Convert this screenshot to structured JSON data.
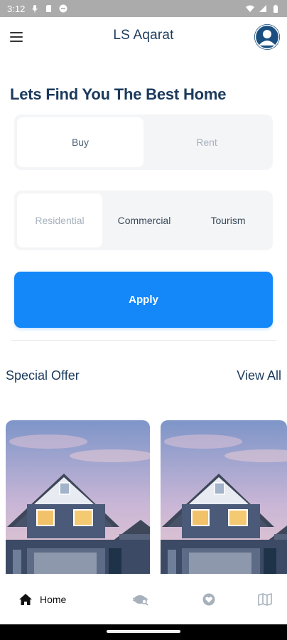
{
  "status_bar": {
    "time": "3:12",
    "icons_left": [
      "mic-icon",
      "sd-card-icon",
      "no-entry-icon"
    ],
    "icons_right": [
      "wifi-icon",
      "signal-icon",
      "battery-icon"
    ]
  },
  "app_bar": {
    "title": "LS Aqarat",
    "menu_icon": "hamburger-menu-icon",
    "avatar_icon": "user-avatar-icon"
  },
  "hero": {
    "title": "Lets Find You The Best Home"
  },
  "listing_type": {
    "options": [
      "Buy",
      "Rent"
    ],
    "selected": "Buy"
  },
  "property_category": {
    "options": [
      "Residential",
      "Commercial",
      "Tourism"
    ],
    "selected": "Residential"
  },
  "apply_label": "Apply",
  "special_offer": {
    "title": "Special Offer",
    "view_all_label": "View All"
  },
  "bottom_nav": {
    "items": [
      {
        "icon": "home-icon",
        "label": "Home",
        "active": true
      },
      {
        "icon": "globe-search-icon"
      },
      {
        "icon": "heart-icon"
      },
      {
        "icon": "map-icon"
      }
    ]
  },
  "colors": {
    "primary": "#1487f9",
    "heading": "#1b3a5c",
    "muted": "#a6b1bd",
    "avatar": "#1a4f80"
  }
}
